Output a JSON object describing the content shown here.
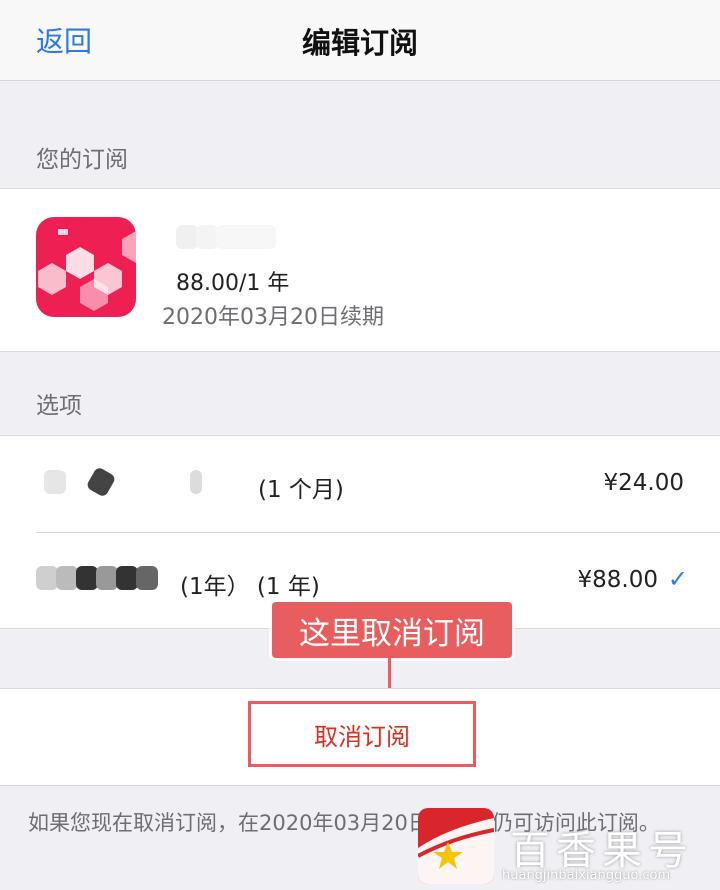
{
  "nav": {
    "back_label": "返回",
    "title": "编辑订阅"
  },
  "subscription_section": {
    "header": "您的订阅",
    "price_line": "88.00/1 年",
    "renew_line": "2020年03月20日续期"
  },
  "options_section": {
    "header": "选项",
    "items": [
      {
        "label": "(1 个月)",
        "price": "¥24.00",
        "selected": false
      },
      {
        "label": "(1年） (1 年)",
        "price": "¥88.00",
        "selected": true
      }
    ]
  },
  "annotation": {
    "text": "这里取消订阅"
  },
  "cancel": {
    "label": "取消订阅"
  },
  "footer": {
    "note": "如果您现在取消订阅，在2020年03月20日之前您仍可访问此订阅。"
  },
  "watermark": {
    "text": "百香果号",
    "url": "huangjinbaixiangguo.com"
  },
  "colors": {
    "accent_blue": "#2a7ae2",
    "app_icon": "#ee1f52",
    "annotation_red": "#e85d5d",
    "cancel_text": "#d9301f"
  }
}
